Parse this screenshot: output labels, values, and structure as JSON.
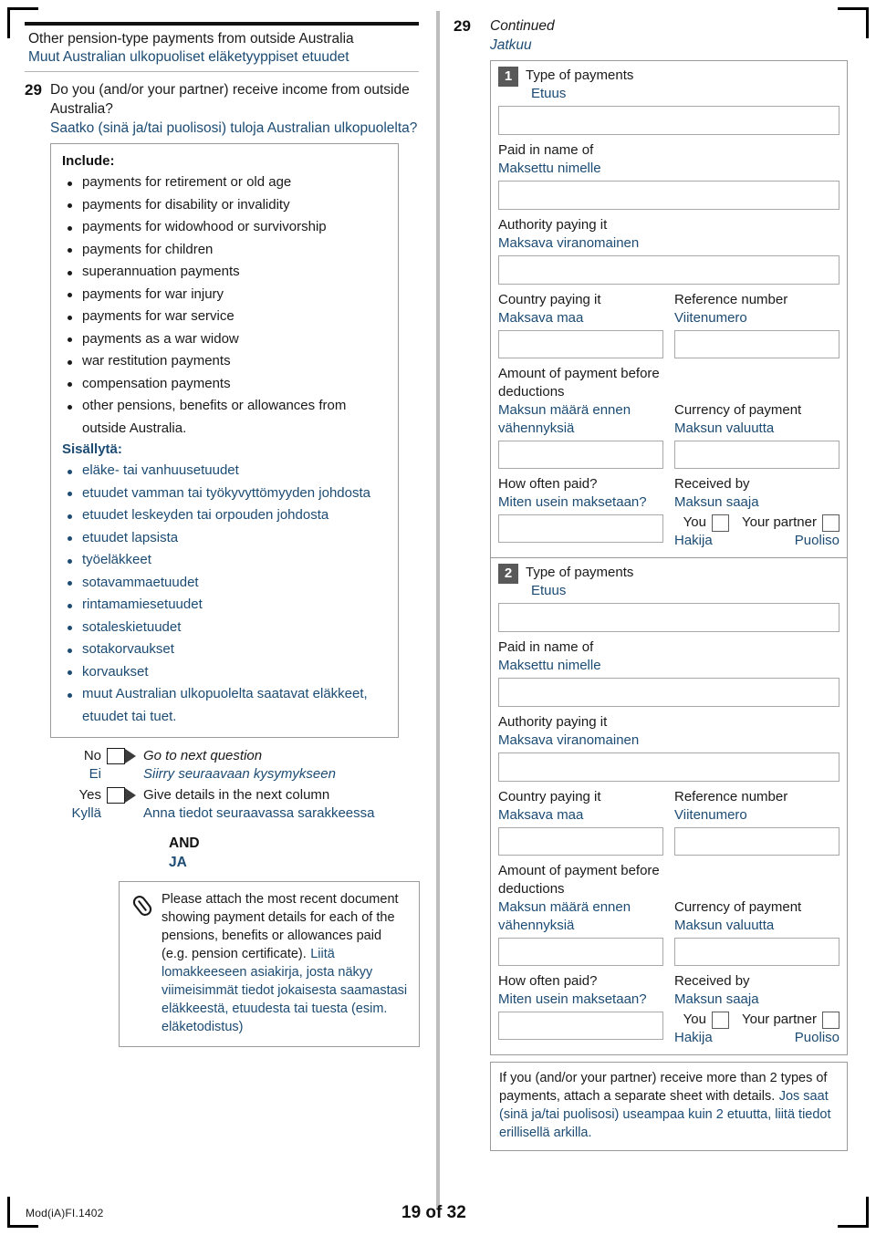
{
  "heading": {
    "en": "Other pension-type payments from outside Australia",
    "fi": "Muut Australian ulkopuoliset eläketyyppiset etuudet"
  },
  "question": {
    "number": "29",
    "en_line1": "Do you (and/or your partner) receive income from outside",
    "en_line2": "Australia?",
    "fi": "Saatko (sinä ja/tai puolisosi) tuloja Australian ulkopuolelta?"
  },
  "include": {
    "title_en": "Include:",
    "items_en": [
      "payments for retirement or old age",
      "payments for disability or invalidity",
      "payments for widowhood or survivorship",
      "payments for children",
      "superannuation payments",
      "payments for war injury",
      "payments for war service",
      "payments as a war widow",
      "war restitution payments",
      "compensation payments",
      "other pensions, benefits or allowances from outside Australia."
    ],
    "title_fi": "Sisällytä:",
    "items_fi": [
      "eläke- tai vanhuusetuudet",
      "etuudet vamman tai työkyvyttömyyden johdosta",
      "etuudet leskeyden tai orpouden johdosta",
      "etuudet lapsista",
      "työeläkkeet",
      "sotavammaetuudet",
      "rintamamiesetuudet",
      "sotaleskietuudet",
      "sotakorvaukset",
      "korvaukset",
      "muut Australian ulkopuolelta saatavat eläkkeet, etuudet tai tuet."
    ]
  },
  "answers": {
    "no_en": "No",
    "no_fi": "Ei",
    "no_action_en": "Go to next question",
    "no_action_fi": "Siirry seuraavaan kysymykseen",
    "yes_en": "Yes",
    "yes_fi": "Kyllä",
    "yes_action_en": "Give details in the next column",
    "yes_action_fi": "Anna tiedot seuraavassa sarakkeessa",
    "and_en": "AND",
    "and_fi": "JA"
  },
  "attach_note": {
    "icon": "paperclip-icon",
    "en": "Please attach the most recent document showing payment details for each of the pensions, benefits or allowances paid (e.g. pension certificate).",
    "fi": "Liitä lomakkeeseen asiakirja, josta näkyy viimeisimmät tiedot jokaisesta saamastasi eläkkeestä, etuudesta tai tuesta (esim. eläketodistus)"
  },
  "right": {
    "number": "29",
    "continued_en": "Continued",
    "continued_fi": "Jatkuu",
    "labels": {
      "type_en": "Type of payments",
      "type_fi": "Etuus",
      "paid_name_en": "Paid in name of",
      "paid_name_fi": "Maksettu nimelle",
      "authority_en": "Authority paying it",
      "authority_fi": "Maksava viranomainen",
      "country_en": "Country paying it",
      "country_fi": "Maksava maa",
      "reference_en": "Reference number",
      "reference_fi": "Viitenumero",
      "amount_en_l1": "Amount of payment before",
      "amount_en_l2": "deductions",
      "amount_fi_l1": "Maksun määrä ennen",
      "amount_fi_l2": "vähennyksiä",
      "currency_en": "Currency of payment",
      "currency_fi": "Maksun valuutta",
      "howoften_en": "How often paid?",
      "howoften_fi": "Miten usein maksetaan?",
      "received_en": "Received by",
      "received_fi": "Maksun saaja",
      "you_en": "You",
      "you_fi": "Hakija",
      "partner_en": "Your partner",
      "partner_fi": "Puoliso"
    },
    "block1_badge": "1",
    "block2_badge": "2",
    "tail_en": "If you (and/or your partner) receive more than 2 types of payments, attach a separate sheet with details.",
    "tail_fi": "Jos saat (sinä ja/tai puolisosi) useampaa kuin 2 etuutta, liitä tiedot erillisellä arkilla."
  },
  "footer": {
    "form_code": "Mod(iA)FI.1402",
    "page": "19 of 32"
  },
  "colors": {
    "finnish_text": "#1c4b73",
    "badge_bg": "#595959",
    "rule": "#b4b4b4",
    "box_border": "#9b9b9b"
  }
}
